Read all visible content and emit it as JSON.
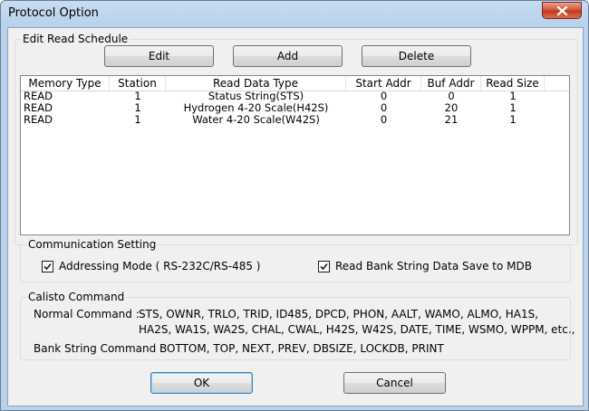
{
  "window": {
    "title": "Protocol Option"
  },
  "edit_read_schedule": {
    "label": "Edit Read Schedule",
    "edit_button": "Edit",
    "add_button": "Add",
    "delete_button": "Delete",
    "columns": [
      "Memory Type",
      "Station",
      "Read Data Type",
      "Start Addr",
      "Buf Addr",
      "Read Size"
    ],
    "rows": [
      [
        "READ",
        "1",
        "Status String(STS)",
        "0",
        "0",
        "1"
      ],
      [
        "READ",
        "1",
        "Hydrogen 4-20 Scale(H42S)",
        "0",
        "20",
        "1"
      ],
      [
        "READ",
        "1",
        "Water 4-20 Scale(W42S)",
        "0",
        "21",
        "1"
      ]
    ]
  },
  "communication_setting": {
    "label": "Communication Setting",
    "addressing_mode": {
      "label": "Addressing Mode ( RS-232C/RS-485 )",
      "checked": true
    },
    "read_bank_save": {
      "label": "Read Bank String Data Save to MDB",
      "checked": true
    }
  },
  "calisto_command": {
    "label": "Calisto Command",
    "normal_label": "Normal Command :",
    "normal_line1": "STS, OWNR, TRLO, TRID, ID485, DPCD, PHON, AALT, WAMO, ALMO, HA1S,",
    "normal_line2": "HA2S, WA1S, WA2S, CHAL, CWAL, H42S, W42S, DATE, TIME, WSMO, WPPM, etc.,",
    "bank_label": "Bank String Command :",
    "bank_line": "BOTTOM, TOP, NEXT, PREV, DBSIZE, LOCKDB, PRINT"
  },
  "footer": {
    "ok_button": "OK",
    "cancel_button": "Cancel"
  },
  "colors": {
    "titlebar": "#b9d1ea",
    "close_button": "#c33a21",
    "dialog_face": "#f0f0f0"
  }
}
